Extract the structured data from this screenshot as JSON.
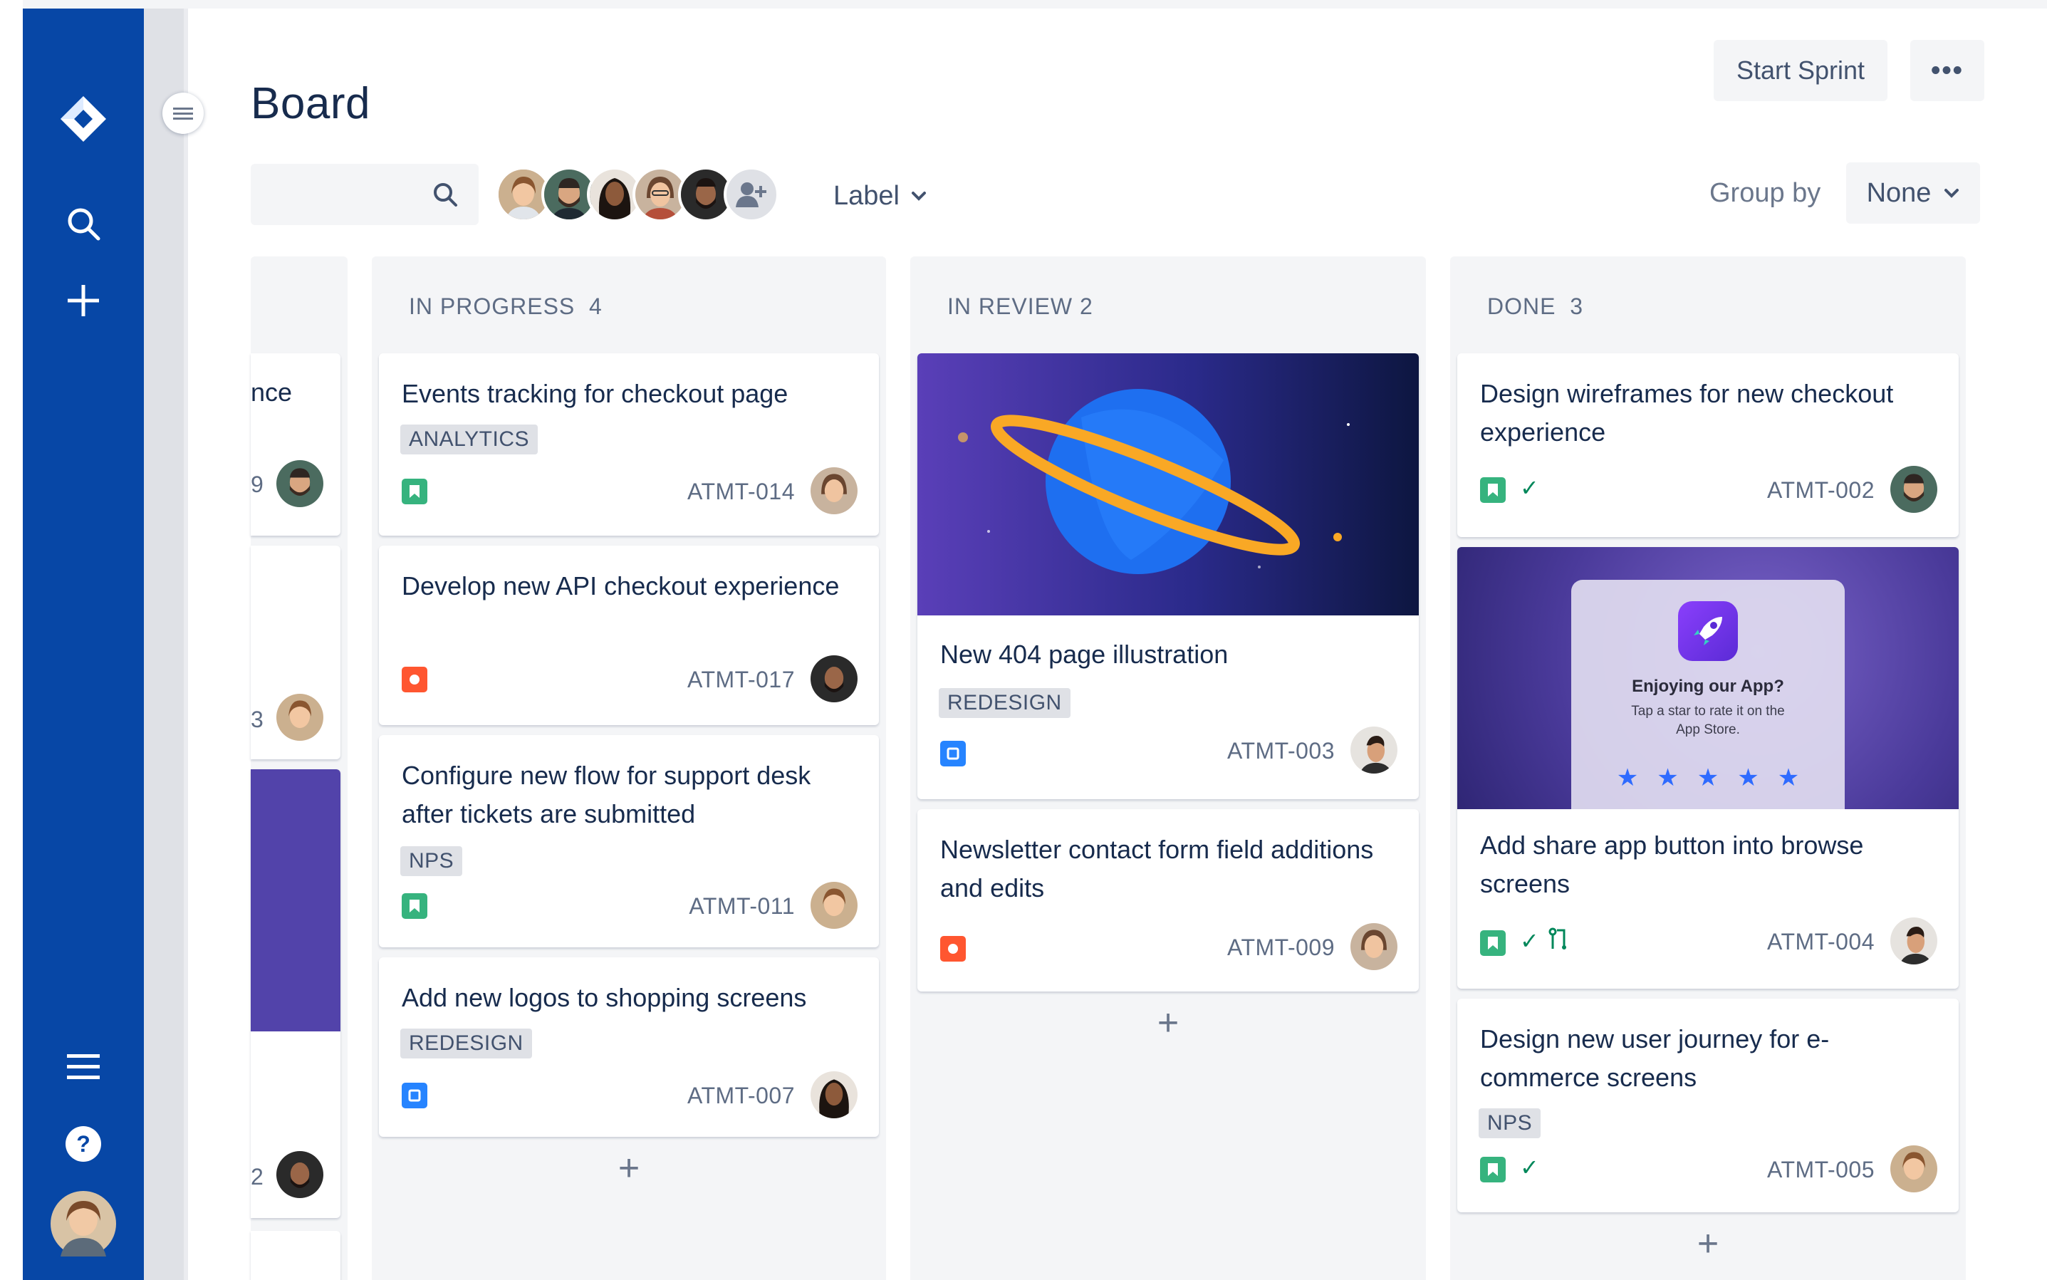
{
  "page": {
    "title": "Board"
  },
  "header": {
    "start_sprint": "Start Sprint",
    "more_label": "•••",
    "label_filter": "Label",
    "group_by": "Group by",
    "group_by_value": "None"
  },
  "colors": {
    "nav": "#0747A6",
    "story": "#36B37E",
    "bug": "#FF5630",
    "task": "#2684FF",
    "purple": "#5243AA"
  },
  "columns": [
    {
      "name": "",
      "count": ""
    },
    {
      "name": "IN PROGRESS",
      "count": "4"
    },
    {
      "name": "IN REVIEW",
      "count": "2"
    },
    {
      "name": "DONE",
      "count": "3"
    }
  ],
  "col0": {
    "card1_title": "nce",
    "card1_key": "9",
    "card2_key": "3",
    "card4_key": "2"
  },
  "col1": {
    "cards": [
      {
        "title": "Events tracking for checkout page",
        "label": "ANALYTICS",
        "key": "ATMT-014",
        "type": "story"
      },
      {
        "title": "Develop new API checkout experience",
        "key": "ATMT-017",
        "type": "bug"
      },
      {
        "title": "Configure new flow for support desk after tickets are submitted",
        "label": "NPS",
        "key": "ATMT-011",
        "type": "story"
      },
      {
        "title": "Add new logos to shopping screens",
        "label": "REDESIGN",
        "key": "ATMT-007",
        "type": "task"
      }
    ]
  },
  "col2": {
    "cards": [
      {
        "title": "New 404 page illustration",
        "label": "REDESIGN",
        "key": "ATMT-003",
        "type": "task"
      },
      {
        "title": "Newsletter contact form field additions and edits",
        "key": "ATMT-009",
        "type": "bug"
      }
    ]
  },
  "col3": {
    "cards": [
      {
        "title": "Design wireframes for new checkout experience",
        "key": "ATMT-002",
        "type": "story"
      },
      {
        "title": "Add share app button into browse screens",
        "key": "ATMT-004",
        "type": "story"
      },
      {
        "title": "Design new user journey for e-commerce screens",
        "label": "NPS",
        "key": "ATMT-005",
        "type": "story"
      }
    ],
    "app_prompt": {
      "title": "Enjoying our App?",
      "line1": "Tap a star to rate it on the",
      "line2": "App Store."
    }
  },
  "add_label": "+"
}
